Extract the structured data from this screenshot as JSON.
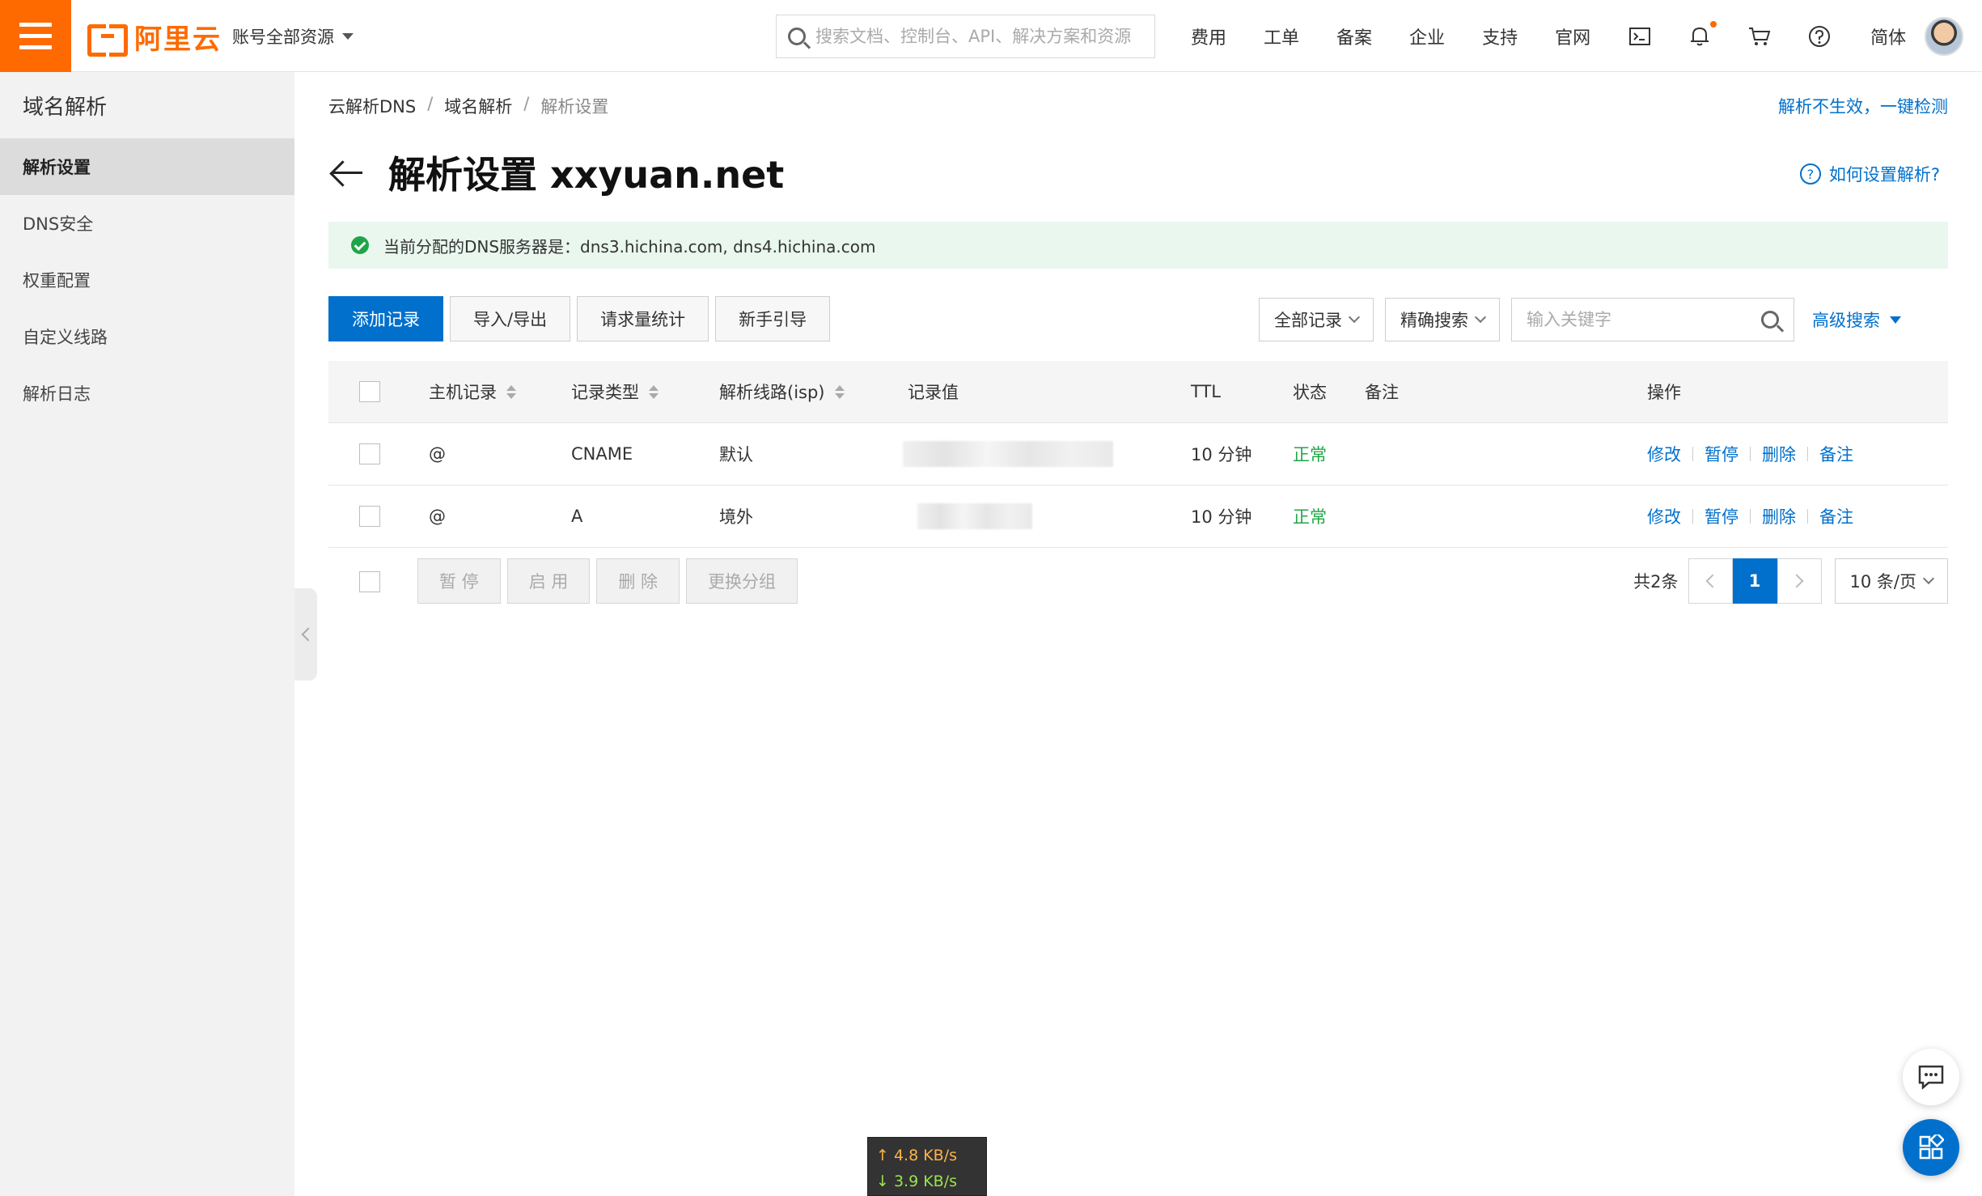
{
  "header": {
    "logo_text": "阿里云",
    "account_scope": "账号全部资源",
    "search_placeholder": "搜索文档、控制台、API、解决方案和资源",
    "nav": [
      "费用",
      "工单",
      "备案",
      "企业",
      "支持",
      "官网"
    ],
    "language": "简体",
    "icons": [
      "terminal-icon",
      "bell-icon",
      "cart-icon",
      "help-icon"
    ]
  },
  "sidebar": {
    "title": "域名解析",
    "items": [
      {
        "label": "解析设置",
        "active": true
      },
      {
        "label": "DNS安全",
        "active": false
      },
      {
        "label": "权重配置",
        "active": false
      },
      {
        "label": "自定义线路",
        "active": false
      },
      {
        "label": "解析日志",
        "active": false
      }
    ]
  },
  "breadcrumb": [
    "云解析DNS",
    "域名解析",
    "解析设置"
  ],
  "top_link": "解析不生效，一键检测",
  "page_title": "解析设置 xxyuan.net",
  "help_link": "如何设置解析?",
  "notice": "当前分配的DNS服务器是：dns3.hichina.com, dns4.hichina.com",
  "toolbar": {
    "add": "添加记录",
    "import_export": "导入/导出",
    "stats": "请求量统计",
    "guide": "新手引导"
  },
  "filters": {
    "all_records": "全部记录",
    "precise_search": "精确搜索",
    "keyword_placeholder": "输入关键字",
    "advanced": "高级搜索"
  },
  "table": {
    "columns": [
      "主机记录",
      "记录类型",
      "解析线路(isp)",
      "记录值",
      "TTL",
      "状态",
      "备注",
      "操作"
    ],
    "rows": [
      {
        "host": "@",
        "type": "CNAME",
        "line": "默认",
        "ttl": "10 分钟",
        "status": "正常",
        "remark": ""
      },
      {
        "host": "@",
        "type": "A",
        "line": "境外",
        "ttl": "10 分钟",
        "status": "正常",
        "remark": ""
      }
    ],
    "row_actions": [
      "修改",
      "暂停",
      "删除",
      "备注"
    ]
  },
  "bulk_actions": [
    "暂 停",
    "启 用",
    "删 除",
    "更换分组"
  ],
  "pagination": {
    "total": "共2条",
    "current_page": "1",
    "page_size": "10 条/页"
  },
  "speed": {
    "up": "4.8 KB/s",
    "down": "3.9 KB/s"
  },
  "colors": {
    "brand": "#ff6a00",
    "primary": "#0070cc",
    "success": "#1fa547"
  }
}
